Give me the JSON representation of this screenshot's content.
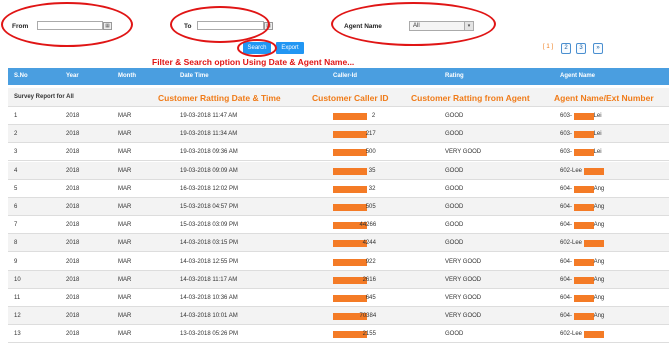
{
  "filters": {
    "from_label": "From",
    "to_label": "To",
    "agent_label": "Agent Name",
    "agent_selected": "All",
    "search_label": "Search",
    "export_label": "Export"
  },
  "pagination": {
    "current": "[ 1 ]",
    "pages": [
      "2",
      "3"
    ],
    "next": "»"
  },
  "annotations": {
    "filter_note": "Filter & Search option Using Date & Agent Name...",
    "datetime_note": "Customer Ratting Date & Time",
    "callerid_note": "Customer Caller ID",
    "rating_note": "Customer  Ratting from Agent",
    "agent_note": "Agent  Name/Ext Number"
  },
  "table": {
    "columns": [
      "S.No",
      "Year",
      "Month",
      "Date Time",
      "Caller-Id",
      "Rating",
      "Agent Name"
    ],
    "summary_label": "Survey Report for All",
    "rows": [
      {
        "sno": "1",
        "year": "2018",
        "month": "MAR",
        "datetime": "19-03-2018 11:47 AM",
        "caller": "2",
        "rating": "GOOD",
        "agent_pre": "603-",
        "agent_post": "Lei"
      },
      {
        "sno": "2",
        "year": "2018",
        "month": "MAR",
        "datetime": "19-03-2018 11:34 AM",
        "caller": "217",
        "rating": "GOOD",
        "agent_pre": "603-",
        "agent_post": "Lei"
      },
      {
        "sno": "3",
        "year": "2018",
        "month": "MAR",
        "datetime": "19-03-2018 09:36 AM",
        "caller": "500",
        "rating": "VERY GOOD",
        "agent_pre": "603-",
        "agent_post": "Lei"
      },
      {
        "sno": "4",
        "year": "2018",
        "month": "MAR",
        "datetime": "19-03-2018 09:09 AM",
        "caller": "35",
        "rating": "GOOD",
        "agent_pre": "602-Lee",
        "agent_post": ""
      },
      {
        "sno": "5",
        "year": "2018",
        "month": "MAR",
        "datetime": "16-03-2018 12:02 PM",
        "caller": "32",
        "rating": "GOOD",
        "agent_pre": "604-",
        "agent_post": "Ang"
      },
      {
        "sno": "6",
        "year": "2018",
        "month": "MAR",
        "datetime": "15-03-2018 04:57 PM",
        "caller": "505",
        "rating": "GOOD",
        "agent_pre": "604-",
        "agent_post": "Ang"
      },
      {
        "sno": "7",
        "year": "2018",
        "month": "MAR",
        "datetime": "15-03-2018 03:09 PM",
        "caller": "44266",
        "rating": "GOOD",
        "agent_pre": "604-",
        "agent_post": "Ang"
      },
      {
        "sno": "8",
        "year": "2018",
        "month": "MAR",
        "datetime": "14-03-2018 03:15 PM",
        "caller": "4244",
        "rating": "GOOD",
        "agent_pre": "602-Lee",
        "agent_post": ""
      },
      {
        "sno": "9",
        "year": "2018",
        "month": "MAR",
        "datetime": "14-03-2018 12:55 PM",
        "caller": "922",
        "rating": "VERY GOOD",
        "agent_pre": "604-",
        "agent_post": "Ang"
      },
      {
        "sno": "10",
        "year": "2018",
        "month": "MAR",
        "datetime": "14-03-2018 11:17 AM",
        "caller": "2616",
        "rating": "VERY GOOD",
        "agent_pre": "604-",
        "agent_post": "Ang"
      },
      {
        "sno": "11",
        "year": "2018",
        "month": "MAR",
        "datetime": "14-03-2018 10:36 AM",
        "caller": "645",
        "rating": "VERY GOOD",
        "agent_pre": "604-",
        "agent_post": "Ang"
      },
      {
        "sno": "12",
        "year": "2018",
        "month": "MAR",
        "datetime": "14-03-2018 10:01 AM",
        "caller": "70384",
        "rating": "VERY GOOD",
        "agent_pre": "604-",
        "agent_post": "Ang"
      },
      {
        "sno": "13",
        "year": "2018",
        "month": "MAR",
        "datetime": "13-03-2018 05:26 PM",
        "caller": "2155",
        "rating": "GOOD",
        "agent_pre": "602-Lee",
        "agent_post": ""
      }
    ]
  },
  "colors": {
    "header_bg": "#4a9ee0",
    "button_bg": "#2196f3",
    "annotation": "#f07b18",
    "redaction": "#f47b26",
    "circle": "#e01515"
  }
}
